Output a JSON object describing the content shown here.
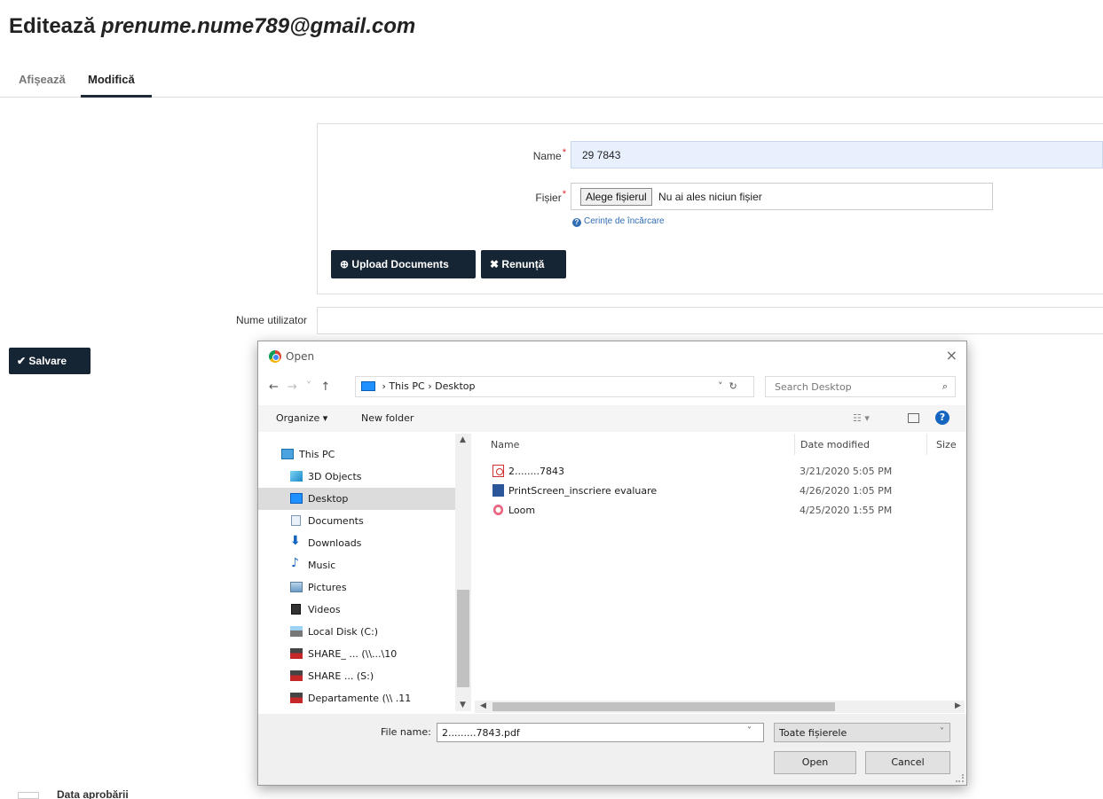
{
  "page": {
    "title_prefix": "Editează",
    "title_email": "prenume.nume789@gmail.com",
    "tabs": [
      {
        "label": "Afișează",
        "active": false
      },
      {
        "label": "Modifică",
        "active": true
      }
    ]
  },
  "upload_form": {
    "name_label": "Name",
    "name_value": "29            7843",
    "file_label": "Fișier",
    "file_button": "Alege fișierul",
    "file_status": "Nu ai ales niciun fișier",
    "requirements_link": "Cerințe de încărcare",
    "upload_button": "Upload Documents",
    "cancel_button": "Renunță"
  },
  "user_field": {
    "label": "Nume utilizator",
    "value": ""
  },
  "save_button": "Salvare",
  "date_label": "Data aprobării",
  "dialog": {
    "title": "Open",
    "close": "×",
    "path": [
      "This PC",
      "Desktop"
    ],
    "search_placeholder": "Search Desktop",
    "organize": "Organize",
    "new_folder": "New folder",
    "help": "?",
    "nav_tree": [
      {
        "label": "This PC",
        "icon": "pc-icon",
        "selected": false
      },
      {
        "label": "3D Objects",
        "icon": "3d-objects-icon",
        "selected": false
      },
      {
        "label": "Desktop",
        "icon": "desktop-icon",
        "selected": true
      },
      {
        "label": "Documents",
        "icon": "documents-icon",
        "selected": false
      },
      {
        "label": "Downloads",
        "icon": "downloads-icon",
        "selected": false
      },
      {
        "label": "Music",
        "icon": "music-icon",
        "selected": false
      },
      {
        "label": "Pictures",
        "icon": "pictures-icon",
        "selected": false
      },
      {
        "label": "Videos",
        "icon": "videos-icon",
        "selected": false
      },
      {
        "label": "Local Disk (C:)",
        "icon": "disk-icon",
        "selected": false
      },
      {
        "label": "SHARE_ ... (\\\\...\\10",
        "icon": "network-drive-icon",
        "selected": false
      },
      {
        "label": "SHARE ... (S:)",
        "icon": "network-drive-icon",
        "selected": false
      },
      {
        "label": "Departamente (\\\\       .11",
        "icon": "network-drive-icon",
        "selected": false
      }
    ],
    "columns": {
      "name": "Name",
      "date": "Date modified",
      "size": "Size"
    },
    "files": [
      {
        "name": "2........7843",
        "date": "3/21/2020 5:05 PM",
        "icon": "pdf-icon"
      },
      {
        "name": "PrintScreen_inscriere evaluare",
        "date": "4/26/2020 1:05 PM",
        "icon": "word-icon"
      },
      {
        "name": "Loom",
        "date": "4/25/2020 1:55 PM",
        "icon": "loom-icon"
      }
    ],
    "file_name_label": "File name:",
    "file_name_value": "2.........7843.pdf",
    "file_type": "Toate fișierele",
    "open_button": "Open",
    "cancel_button": "Cancel"
  },
  "colors": {
    "dark_button": "#162533",
    "required": "#d9232e",
    "link": "#2f6db5",
    "selected_tree": "#dcdcdc",
    "autofill": "#e8f0fe"
  }
}
